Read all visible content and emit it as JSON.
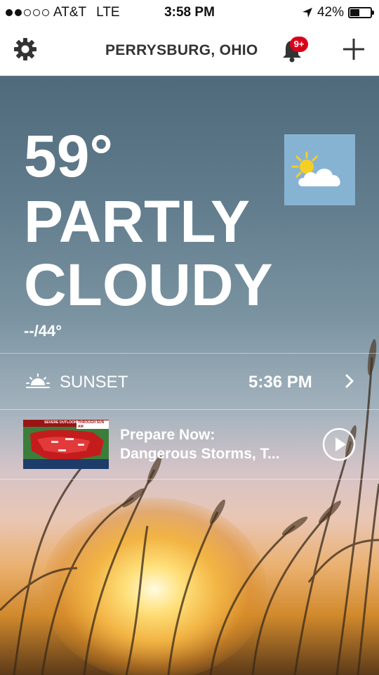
{
  "status_bar": {
    "carrier": "AT&T",
    "network": "LTE",
    "time": "3:58 PM",
    "battery": "42%",
    "battery_level": 0.42,
    "signal_bars_filled": 2,
    "signal_bars_total": 5
  },
  "header": {
    "location": "PERRYSBURG, OHIO",
    "notification_badge": "9+",
    "icons": {
      "settings": "gear-icon",
      "notifications": "bell-icon",
      "add": "plus-icon"
    }
  },
  "weather": {
    "temperature": "59°",
    "condition_line1": "PARTLY",
    "condition_line2": "CLOUDY",
    "hi_lo": "--/44°",
    "condition_icon": "partly-cloudy-icon"
  },
  "sunset": {
    "label": "SUNSET",
    "time": "5:36 PM",
    "icon": "sunset-icon"
  },
  "video": {
    "title_line1": "Prepare Now:",
    "title_line2": "Dangerous Storms, T...",
    "thumbnail_header_left": "SEVERE OUTLOOK",
    "thumbnail_header_right": "THROUGH SUN AM"
  },
  "colors": {
    "badge": "#d9001b",
    "condition_tile": "#87b3d3"
  }
}
